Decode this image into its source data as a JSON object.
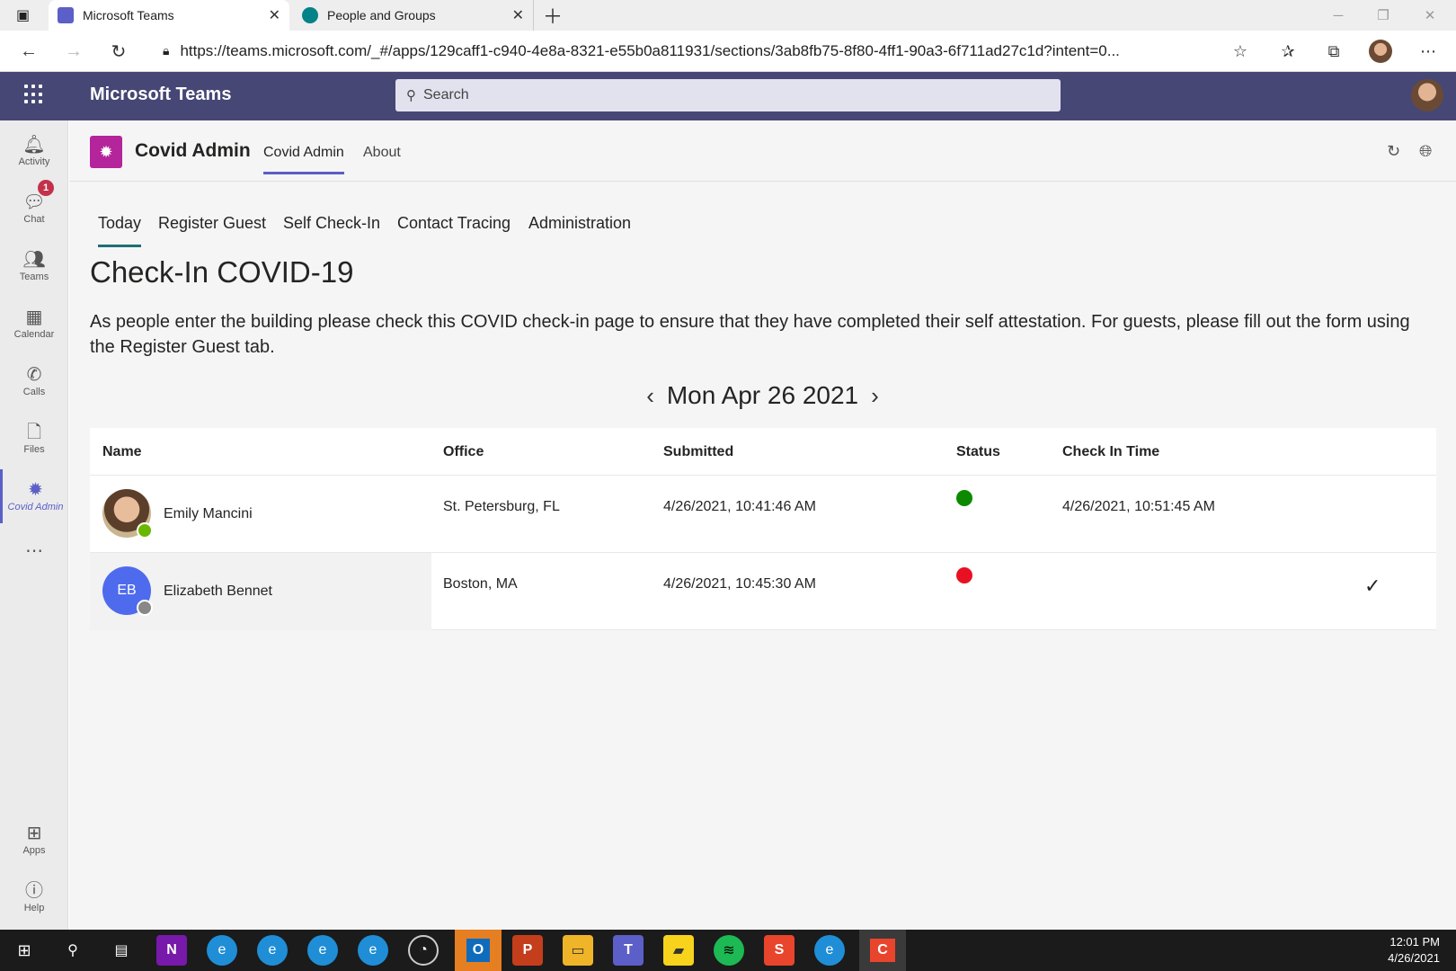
{
  "browser": {
    "tabs": [
      {
        "label": "Microsoft Teams",
        "icon": "teams-icon",
        "color": "#5b5fc7"
      },
      {
        "label": "People and Groups",
        "icon": "sharepoint-icon",
        "color": "#038387"
      }
    ],
    "url": "https://teams.microsoft.com/_#/apps/129caff1-c940-4e8a-8321-e55b0a811931/sections/3ab8fb75-8f80-4ff1-90a3-6f711ad27c1d?intent=0..."
  },
  "teams": {
    "brand": "Microsoft Teams",
    "search_placeholder": "Search",
    "rail": [
      {
        "label": "Activity",
        "icon": "bell-icon"
      },
      {
        "label": "Chat",
        "icon": "chat-icon",
        "badge": "1"
      },
      {
        "label": "Teams",
        "icon": "people-icon"
      },
      {
        "label": "Calendar",
        "icon": "calendar-icon"
      },
      {
        "label": "Calls",
        "icon": "phone-icon"
      },
      {
        "label": "Files",
        "icon": "file-icon"
      },
      {
        "label": "Covid Admin",
        "icon": "virus-icon"
      },
      {
        "label": "",
        "icon": "more-icon"
      },
      {
        "label": "Apps",
        "icon": "apps-icon"
      },
      {
        "label": "Help",
        "icon": "help-icon"
      }
    ]
  },
  "app": {
    "title": "Covid Admin",
    "tabs": [
      "Covid Admin",
      "About"
    ],
    "subtabs": [
      "Today",
      "Register Guest",
      "Self Check-In",
      "Contact Tracing",
      "Administration"
    ],
    "page_title": "Check-In COVID-19",
    "intro": "As people enter the building please check this COVID check-in page to ensure that they have completed their self attestation. For guests, please fill out the form using the Register Guest tab.",
    "date": "Mon Apr 26 2021",
    "columns": [
      "Name",
      "Office",
      "Submitted",
      "Status",
      "Check In Time"
    ],
    "rows": [
      {
        "name": "Emily Mancini",
        "initials": "",
        "office": "St. Petersburg, FL",
        "submitted": "4/26/2021, 10:41:46 AM",
        "status_color": "#0b8a00",
        "check_in": "4/26/2021, 10:51:45 AM",
        "presence_color": "#6bb700"
      },
      {
        "name": "Elizabeth Bennet",
        "initials": "EB",
        "office": "Boston, MA",
        "submitted": "4/26/2021, 10:45:30 AM",
        "status_color": "#e81123",
        "check_in": "",
        "presence_color": "#8a8886"
      }
    ]
  },
  "taskbar": {
    "time": "12:01 PM",
    "date": "4/26/2021"
  }
}
